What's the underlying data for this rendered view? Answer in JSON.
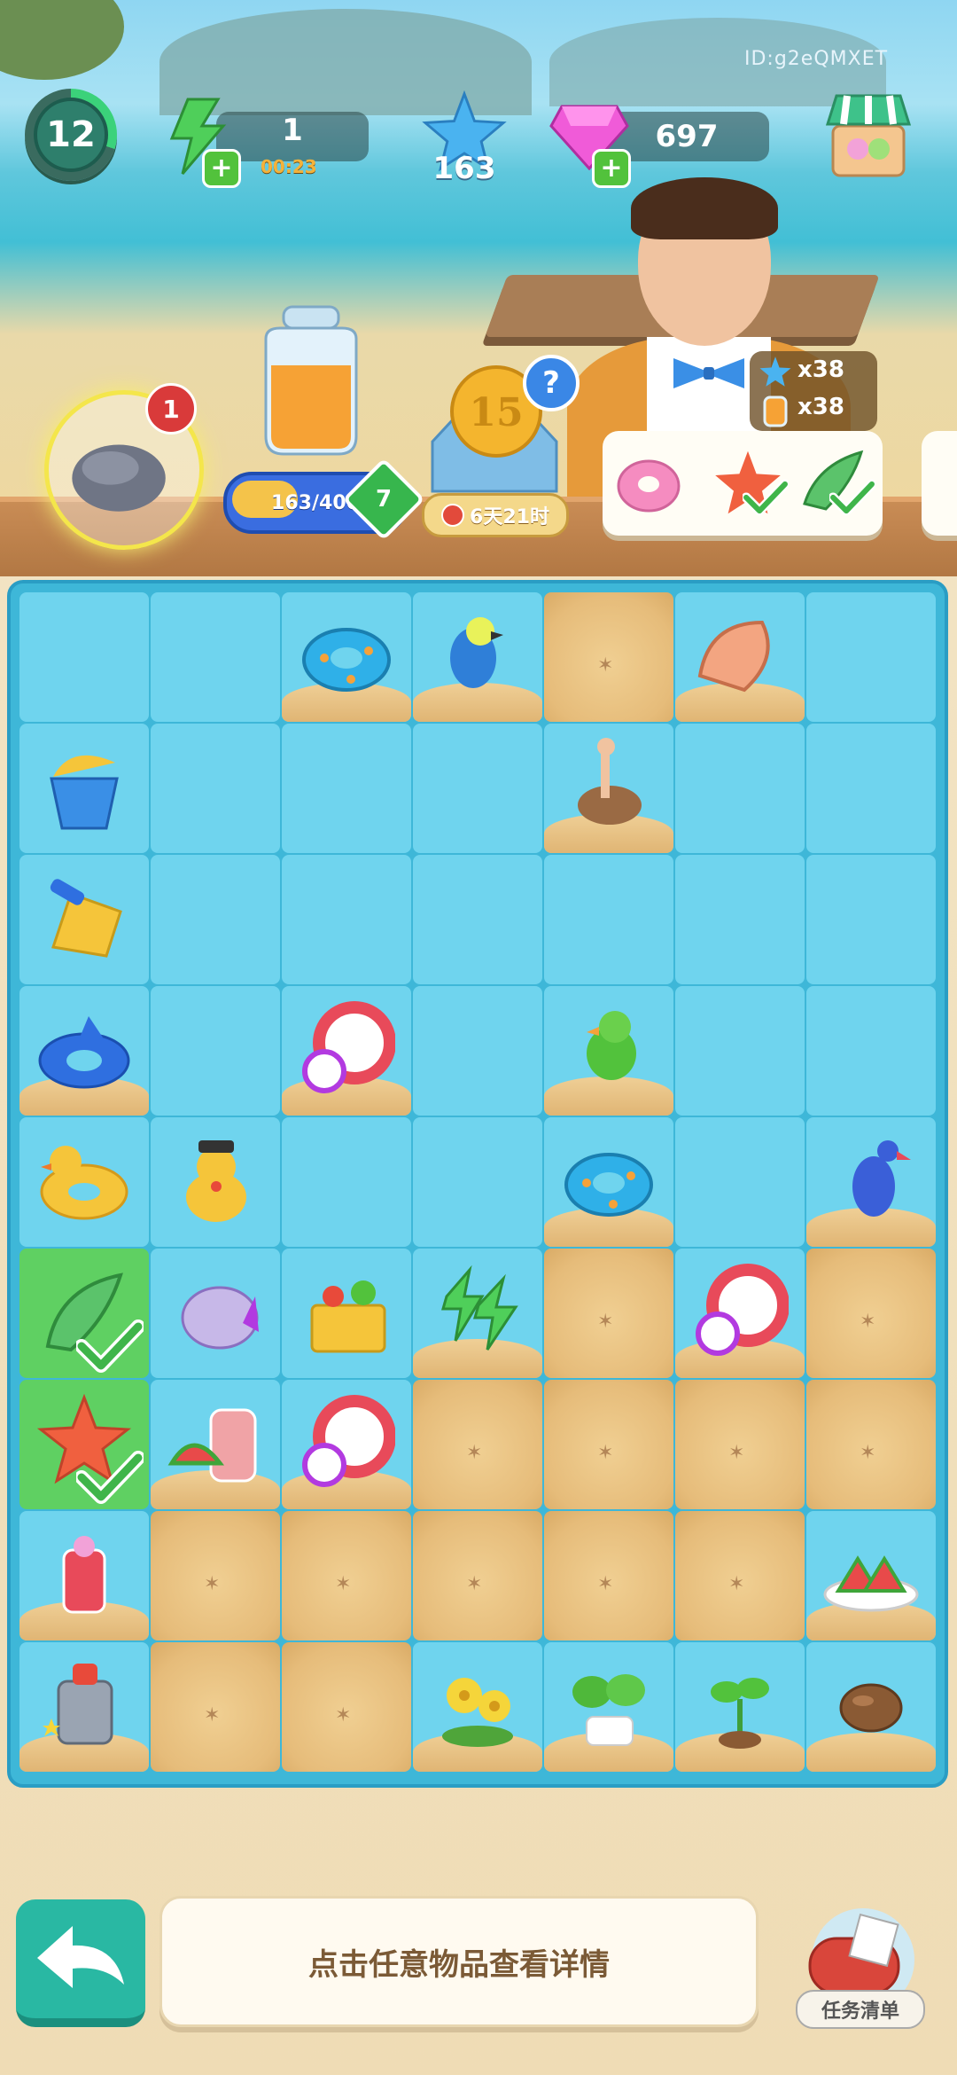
{
  "hud": {
    "player_id": "ID:g2eQMXET",
    "level": "12",
    "energy": {
      "value": "1",
      "timer": "00:23"
    },
    "stars": "163",
    "gems": "697"
  },
  "scene": {
    "rock_badge": "1",
    "jar_progress": {
      "label": "163/400",
      "fraction": 0.41,
      "level": "7"
    },
    "event": {
      "coin_value": "15",
      "help": "?",
      "timer": "6天21时"
    },
    "reward": {
      "star_amount": "x38",
      "jar_amount": "x38"
    },
    "order_items": [
      "pink-donut-icon",
      "starfish-icon",
      "conch-shell-icon"
    ]
  },
  "board": {
    "rows": 9,
    "cols": 7,
    "cells": [
      [
        "empty",
        "empty",
        "donut-float-blue",
        "parrot-blue",
        "sand",
        "conch-shell",
        "empty"
      ],
      [
        "bucket-shell",
        "empty",
        "empty",
        "empty",
        "ostrich",
        "empty",
        "empty"
      ],
      [
        "yellow-shovel",
        "empty",
        "empty",
        "empty",
        "empty",
        "empty",
        "empty"
      ],
      [
        "dolphin-float",
        "empty",
        "lifebuoy-ball",
        "empty",
        "parrot-green",
        "empty",
        "empty"
      ],
      [
        "duck-float",
        "duck-hat",
        "empty",
        "empty",
        "donut-float-blue",
        "empty",
        "bird-blue"
      ],
      [
        "conch-shell-check",
        "shell-crystal",
        "surf-basket",
        "energy-bolts",
        "sand",
        "lifebuoy-ball",
        "sand"
      ],
      [
        "starfish-check",
        "watermelon-juice",
        "lifebuoy-ball",
        "sand",
        "sand",
        "sand",
        "sand"
      ],
      [
        "fruit-drink",
        "sand",
        "sand",
        "sand",
        "sand",
        "sand",
        "watermelon-plate"
      ],
      [
        "juicer-machine",
        "sand",
        "sand",
        "yellow-flowers",
        "potted-plant",
        "sprout",
        "seed"
      ]
    ]
  },
  "bottom": {
    "info_text": "点击任意物品查看详情",
    "task_label": "任务清单"
  },
  "colors": {
    "board": "#3eb7d8",
    "cell": "#6fd4ee",
    "sand": "#e6bc7a",
    "selected": "#5fd062",
    "back_button": "#29b8a3"
  }
}
